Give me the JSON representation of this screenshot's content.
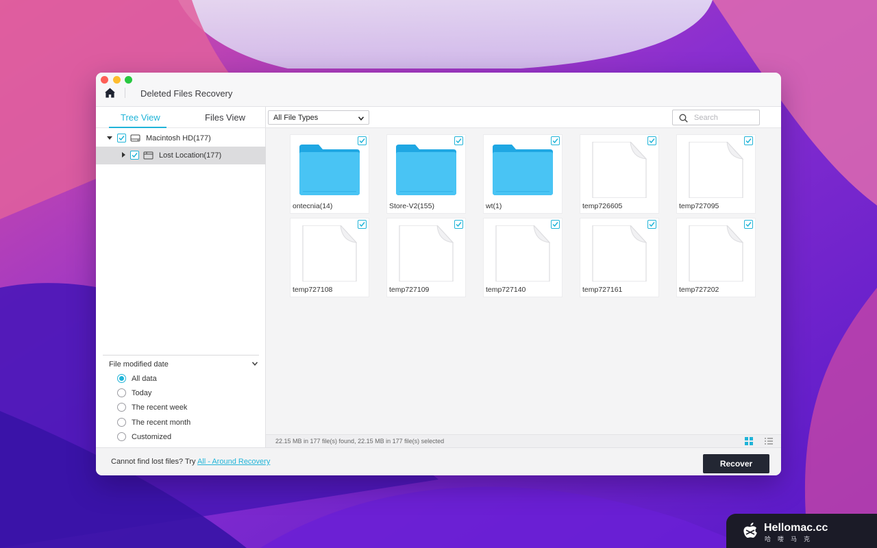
{
  "app": {
    "title": "Deleted Files Recovery"
  },
  "sidebar": {
    "tabs": [
      {
        "label": "Tree View",
        "active": true
      },
      {
        "label": "Files View",
        "active": false
      }
    ],
    "tree": [
      {
        "label": "Macintosh HD(177)",
        "icon": "hard-drive-icon",
        "checked": true,
        "expanded": true
      },
      {
        "label": "Lost Location(177)",
        "icon": "folder-outline-icon",
        "checked": true,
        "expanded": false,
        "selected": true
      }
    ],
    "filter": {
      "title": "File modified date",
      "options": [
        {
          "label": "All data",
          "selected": true
        },
        {
          "label": "Today",
          "selected": false
        },
        {
          "label": "The recent week",
          "selected": false
        },
        {
          "label": "The recent month",
          "selected": false
        },
        {
          "label": "Customized",
          "selected": false
        }
      ]
    }
  },
  "toolbar": {
    "file_type": "All File Types",
    "search_placeholder": "Search"
  },
  "files": [
    {
      "name": "ontecnia(14)",
      "type": "folder",
      "checked": true
    },
    {
      "name": "Store-V2(155)",
      "type": "folder",
      "checked": true
    },
    {
      "name": "wt(1)",
      "type": "folder",
      "checked": true
    },
    {
      "name": "temp726605",
      "type": "file",
      "checked": true
    },
    {
      "name": "temp727095",
      "type": "file",
      "checked": true
    },
    {
      "name": "temp727108",
      "type": "file",
      "checked": true
    },
    {
      "name": "temp727109",
      "type": "file",
      "checked": true
    },
    {
      "name": "temp727140",
      "type": "file",
      "checked": true
    },
    {
      "name": "temp727161",
      "type": "file",
      "checked": true
    },
    {
      "name": "temp727202",
      "type": "file",
      "checked": true
    }
  ],
  "status": {
    "text": "22.15 MB in 177 file(s) found, 22.15 MB in 177 file(s) selected"
  },
  "footer": {
    "prompt": "Cannot find lost files? Try ",
    "link": "All - Around Recovery",
    "recover": "Recover"
  },
  "watermark": {
    "title": "Hellomac.cc",
    "subtitle": "哈喽马克"
  },
  "colors": {
    "accent": "#20b4d8",
    "folder": "#3fc3f3",
    "button": "#232733"
  }
}
